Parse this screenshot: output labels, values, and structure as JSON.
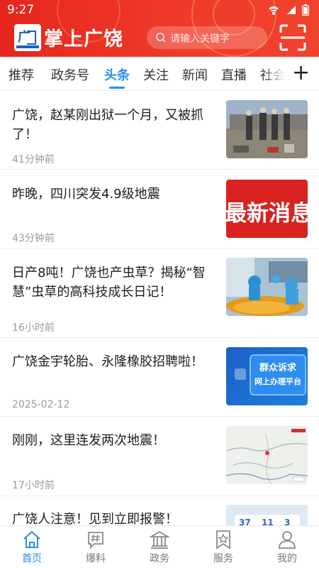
{
  "status_bar": {
    "time": "9:27"
  },
  "header": {
    "logo_text": "掌上广饶",
    "search_placeholder": "请输入关键字"
  },
  "tabs": [
    {
      "label": "推荐",
      "active": false
    },
    {
      "label": "政务号",
      "active": false
    },
    {
      "label": "头条",
      "active": true
    },
    {
      "label": "关注",
      "active": false
    },
    {
      "label": "新闻",
      "active": false
    },
    {
      "label": "直播",
      "active": false
    },
    {
      "label": "社会",
      "active": false
    }
  ],
  "tabs_add_label": "+",
  "news": [
    {
      "title": "广饶，赵某刚出狱一个月，又被抓了！",
      "time": "41分钟前",
      "thumb": "photo-people-outdoor"
    },
    {
      "title": "昨晚，四川突发4.9级地震",
      "time": "43分钟前",
      "thumb_text": "最新消息"
    },
    {
      "title": "日产8吨！广饶也产虫草？揭秘“智慧”虫草的高科技成长日记！",
      "time": "16小时前",
      "thumb": "photo-factory-workers"
    },
    {
      "title": "广饶金宇轮胎、永隆橡胶招聘啦！",
      "time": "2025-02-12",
      "thumb_text": "群众诉求 网上办理平台",
      "thumb_text_line1": "群众诉求",
      "thumb_text_line2": "网上办理平台"
    },
    {
      "title": "刚刚，这里连发两次地震！",
      "time": "17小时前",
      "thumb": "map-earthquake"
    },
    {
      "title": "广饶人注意！见到立即报警！",
      "time": "",
      "thumb_nums": [
        "37",
        "11",
        "3"
      ]
    }
  ],
  "bottom_nav": [
    {
      "label": "首页",
      "icon": "home-icon",
      "active": true
    },
    {
      "label": "爆料",
      "icon": "hashtag-chat-icon",
      "active": false
    },
    {
      "label": "政务",
      "icon": "government-building-icon",
      "active": false
    },
    {
      "label": "服务",
      "icon": "star-bookmark-icon",
      "active": false
    },
    {
      "label": "我的",
      "icon": "user-icon",
      "active": false
    }
  ],
  "colors": {
    "header_red": "#e5261d",
    "accent_blue": "#2b8ef0",
    "news_red_banner": "#d8221f",
    "nav_inactive": "#777777"
  }
}
